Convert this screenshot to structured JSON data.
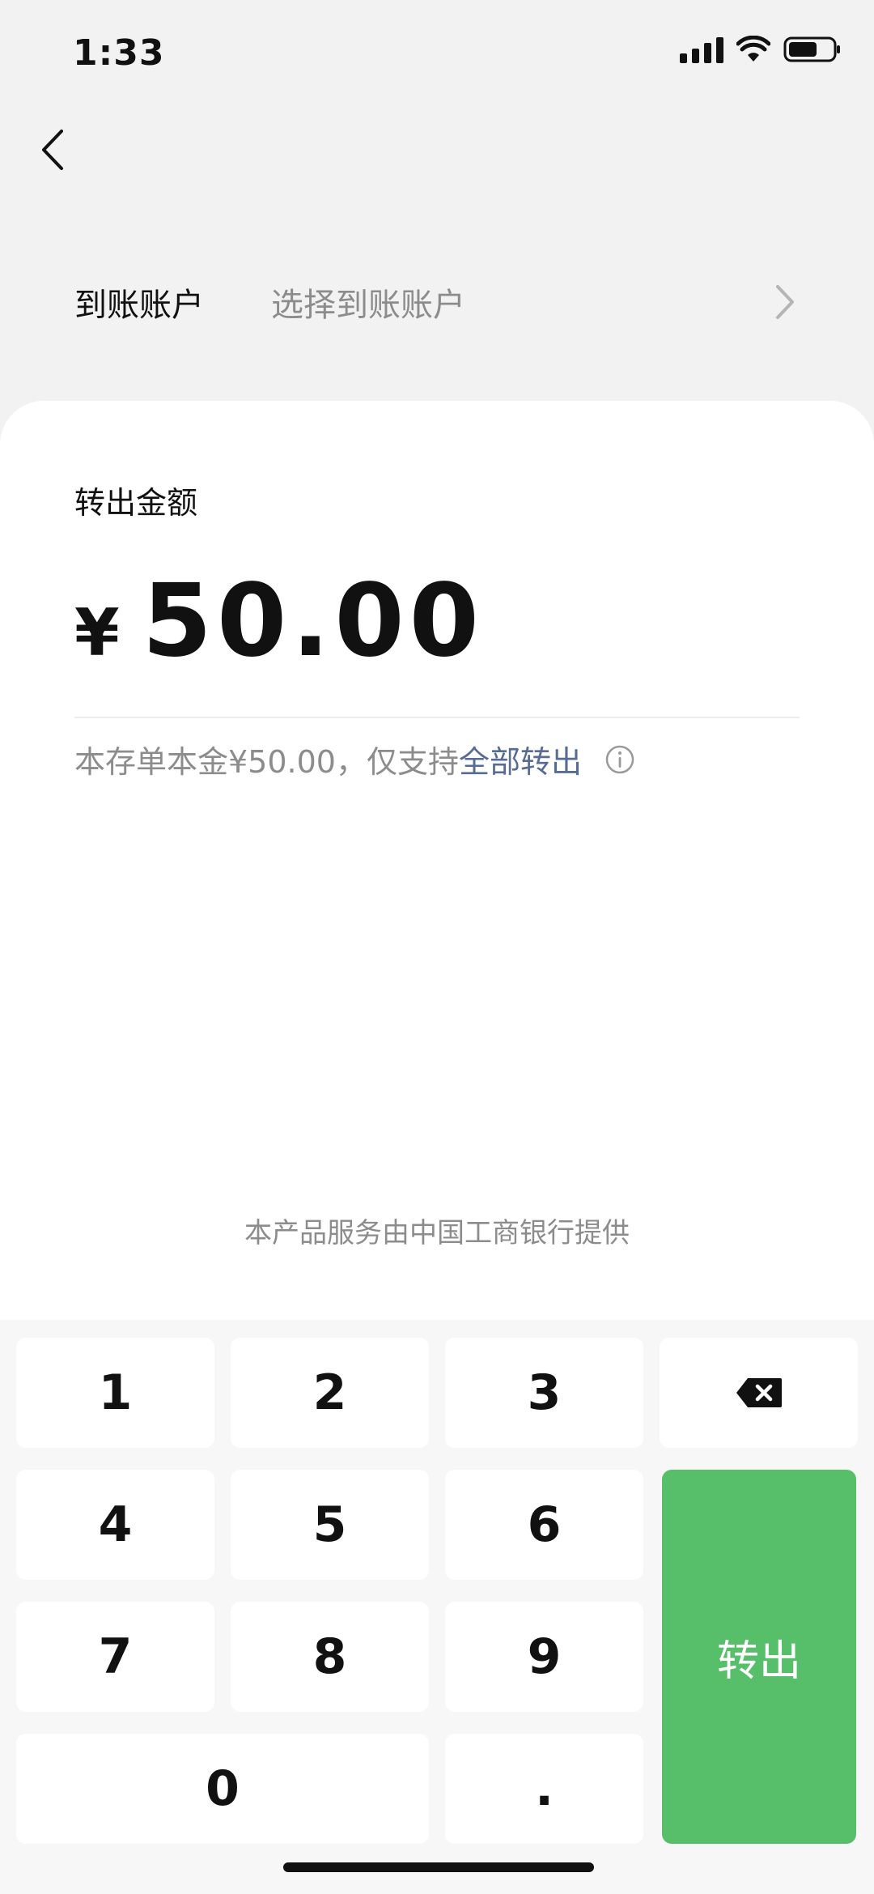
{
  "status_bar": {
    "time": "1:33"
  },
  "account": {
    "label": "到账账户",
    "placeholder": "选择到账账户"
  },
  "transfer": {
    "label": "转出金额",
    "currency_symbol": "¥",
    "amount": "50.00",
    "hint_prefix": "本存单本金¥50.00，仅支持",
    "hint_link": "全部转出",
    "provider_note": "本产品服务由中国工商银行提供"
  },
  "keypad": {
    "keys": [
      "1",
      "2",
      "3",
      "4",
      "5",
      "6",
      "7",
      "8",
      "9",
      "0",
      "."
    ],
    "confirm_label": "转出"
  },
  "colors": {
    "accent_green": "#57BE6A",
    "link_blue": "#576B95",
    "secondary_text": "#8C8C8C",
    "background": "#F2F2F2"
  },
  "icons": [
    "back-arrow-icon",
    "chevron-right-icon",
    "info-icon",
    "backspace-icon",
    "signal-icon",
    "wifi-icon",
    "battery-icon"
  ]
}
